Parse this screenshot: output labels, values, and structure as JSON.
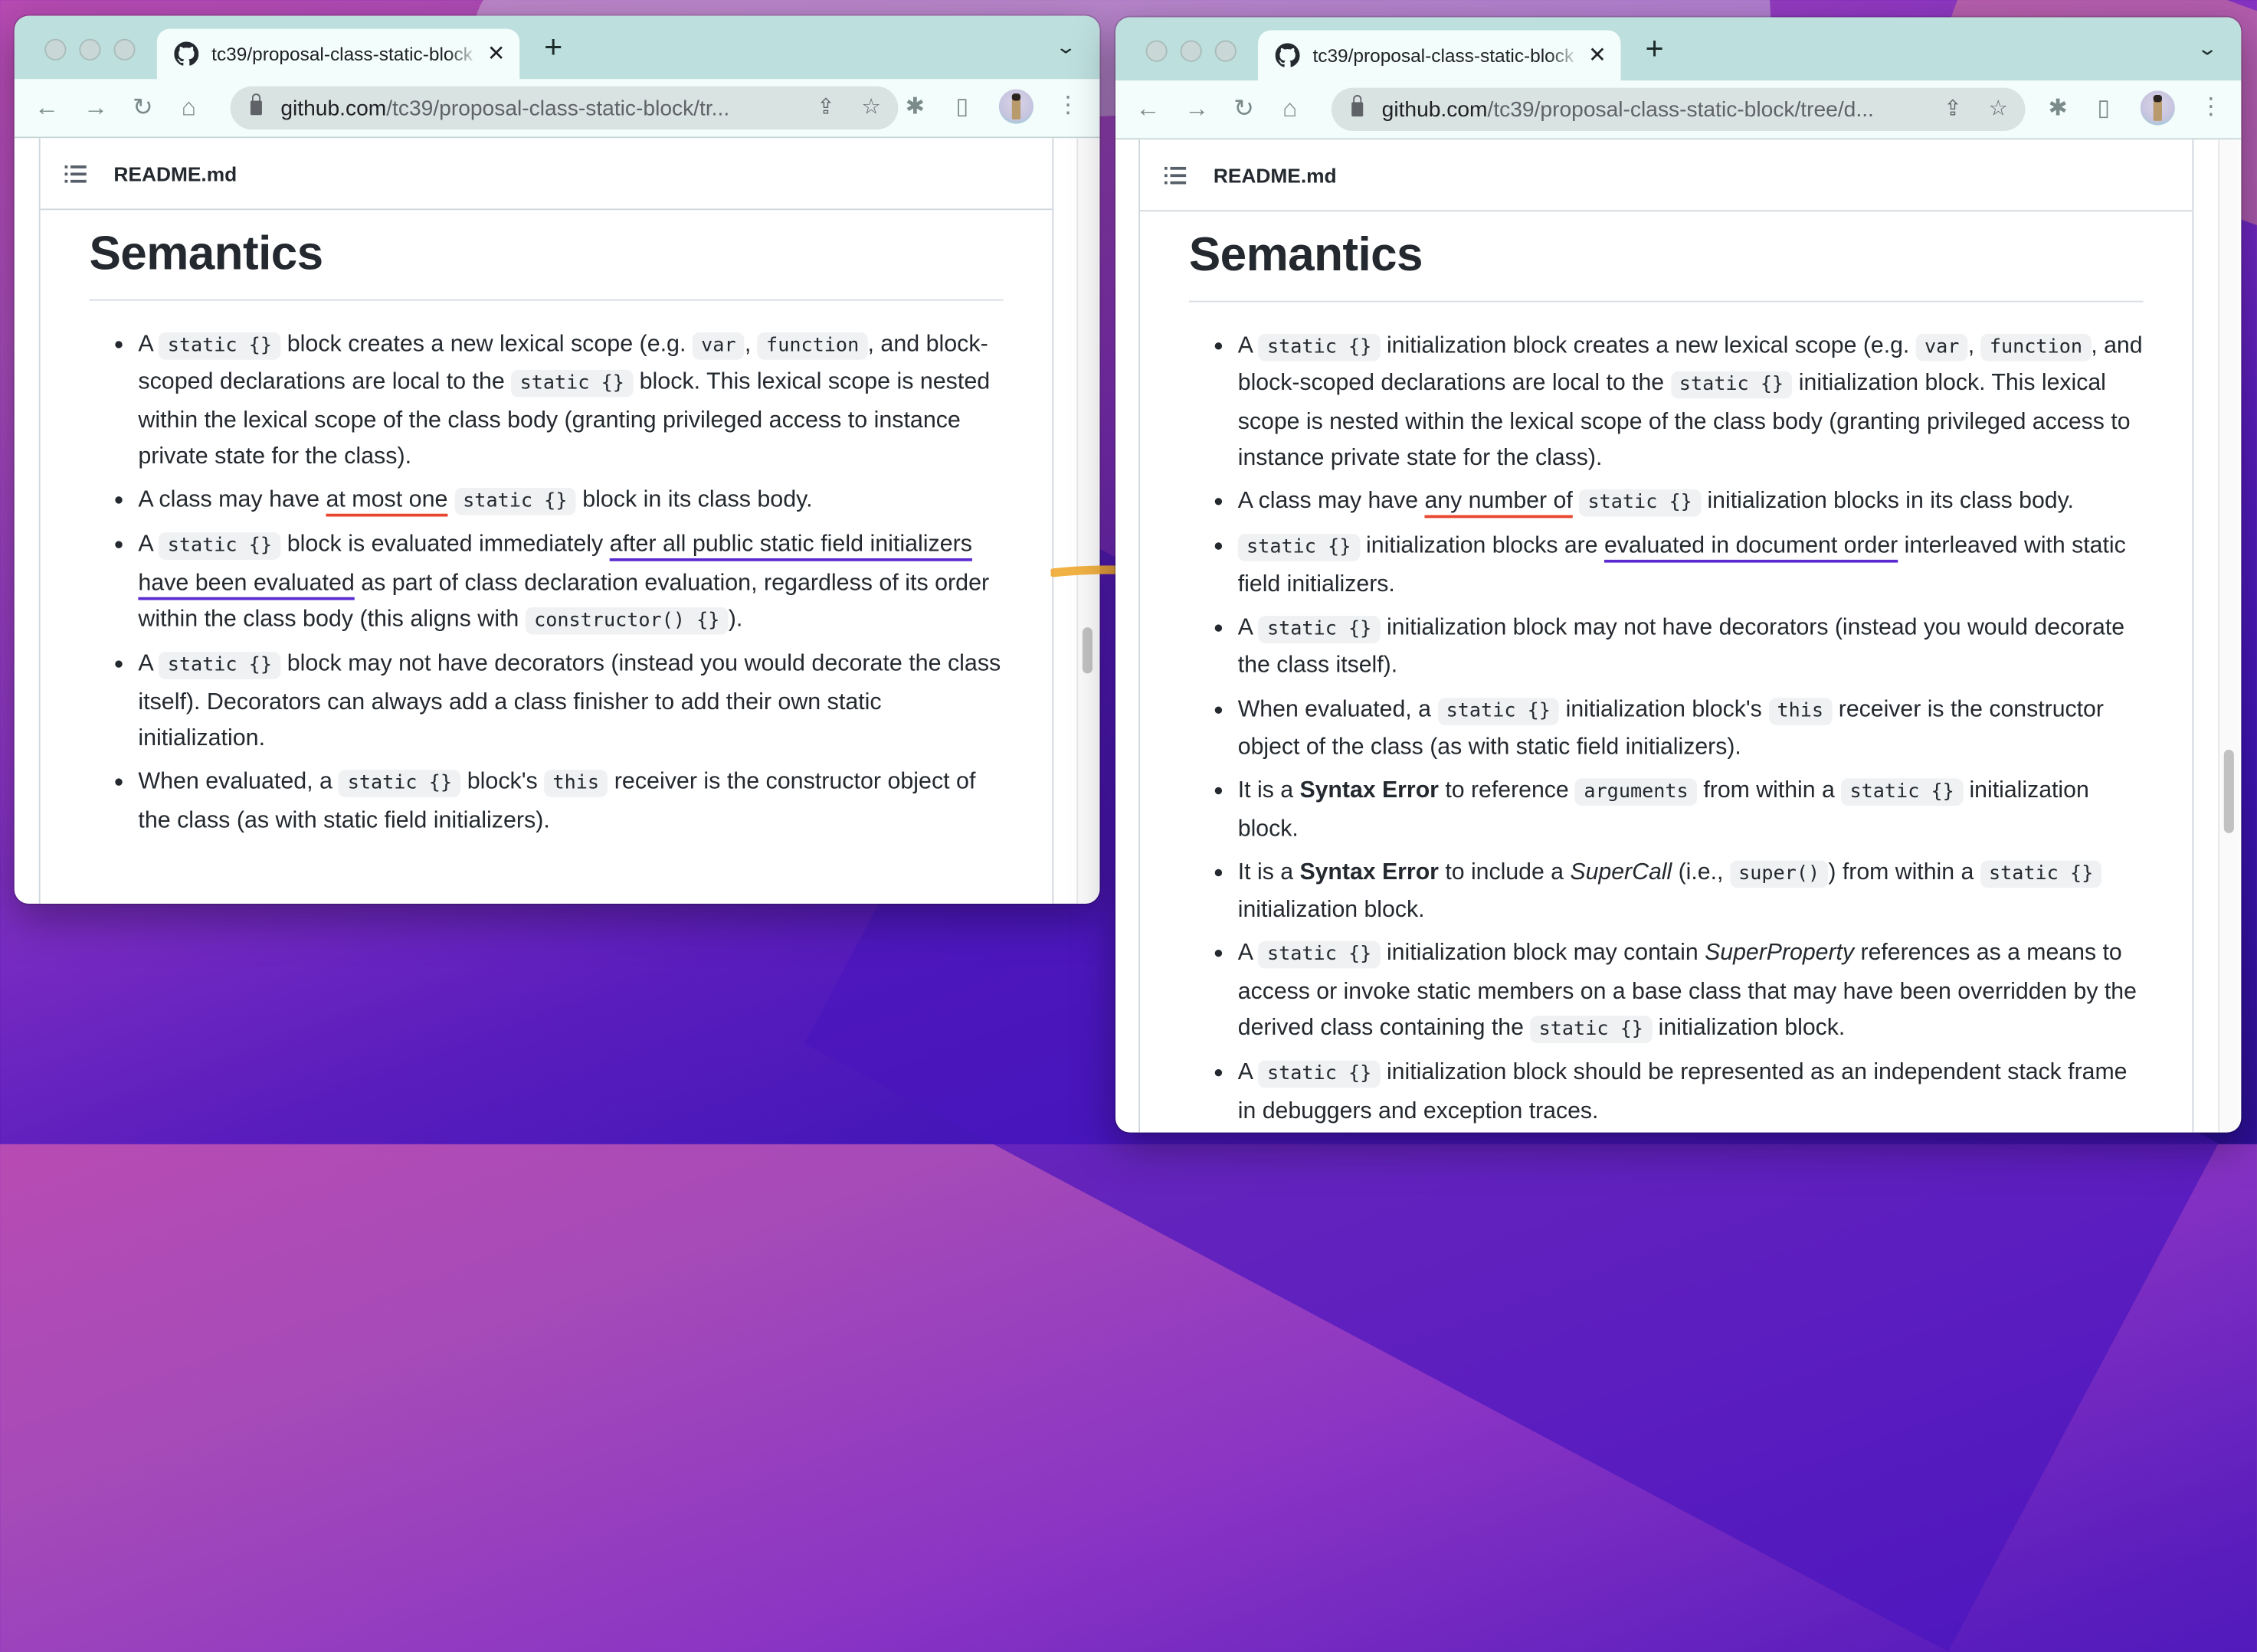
{
  "left_window": {
    "tab_title": "tc39/proposal-class-static-block",
    "url_host": "github.com",
    "url_path": "/tc39/proposal-class-static-block/tr...",
    "file_name": "README.md",
    "heading": "Semantics",
    "bullets": [
      {
        "parts": [
          {
            "t": "text",
            "v": "A "
          },
          {
            "t": "code",
            "v": "static {}"
          },
          {
            "t": "text",
            "v": " block creates a new lexical scope (e.g. "
          },
          {
            "t": "code",
            "v": "var"
          },
          {
            "t": "text",
            "v": ", "
          },
          {
            "t": "code",
            "v": "function"
          },
          {
            "t": "text",
            "v": ", and block-scoped declarations are local to the "
          },
          {
            "t": "code",
            "v": "static {}"
          },
          {
            "t": "text",
            "v": " block. This lexical scope is nested within the lexical scope of the class body (granting privileged access to instance private state for the class)."
          }
        ]
      },
      {
        "parts": [
          {
            "t": "text",
            "v": "A class may have "
          },
          {
            "t": "u-red",
            "v": "at most one"
          },
          {
            "t": "text",
            "v": " "
          },
          {
            "t": "code",
            "v": "static {}"
          },
          {
            "t": "text",
            "v": " block in its class body."
          }
        ]
      },
      {
        "parts": [
          {
            "t": "text",
            "v": "A "
          },
          {
            "t": "code",
            "v": "static {}"
          },
          {
            "t": "text",
            "v": " block is evaluated immediately "
          },
          {
            "t": "u-blue",
            "v": "after all public static field initializers have been evaluated"
          },
          {
            "t": "text",
            "v": " as part of class declaration evaluation, regardless of its order within the class body (this aligns with "
          },
          {
            "t": "code",
            "v": "constructor() {}"
          },
          {
            "t": "text",
            "v": ")."
          }
        ]
      },
      {
        "parts": [
          {
            "t": "text",
            "v": "A "
          },
          {
            "t": "code",
            "v": "static {}"
          },
          {
            "t": "text",
            "v": " block may not have decorators (instead you would decorate the class itself). Decorators can always add a class finisher to add their own static initialization."
          }
        ]
      },
      {
        "parts": [
          {
            "t": "text",
            "v": "When evaluated, a "
          },
          {
            "t": "code",
            "v": "static {}"
          },
          {
            "t": "text",
            "v": " block's "
          },
          {
            "t": "code",
            "v": "this"
          },
          {
            "t": "text",
            "v": " receiver is the constructor object of the class (as with static field initializers)."
          }
        ]
      }
    ]
  },
  "right_window": {
    "tab_title": "tc39/proposal-class-static-block",
    "url_host": "github.com",
    "url_path": "/tc39/proposal-class-static-block/tree/d...",
    "file_name": "README.md",
    "heading": "Semantics",
    "bullets": [
      {
        "parts": [
          {
            "t": "text",
            "v": "A "
          },
          {
            "t": "code",
            "v": "static {}"
          },
          {
            "t": "text",
            "v": " initialization block creates a new lexical scope (e.g. "
          },
          {
            "t": "code",
            "v": "var"
          },
          {
            "t": "text",
            "v": ", "
          },
          {
            "t": "code",
            "v": "function"
          },
          {
            "t": "text",
            "v": ", and block-scoped declarations are local to the "
          },
          {
            "t": "code",
            "v": "static {}"
          },
          {
            "t": "text",
            "v": " initialization block. This lexical scope is nested within the lexical scope of the class body (granting privileged access to instance private state for the class)."
          }
        ]
      },
      {
        "parts": [
          {
            "t": "text",
            "v": "A class may have "
          },
          {
            "t": "u-red",
            "v": "any number of"
          },
          {
            "t": "text",
            "v": " "
          },
          {
            "t": "code",
            "v": "static {}"
          },
          {
            "t": "text",
            "v": " initialization blocks in its class body."
          }
        ]
      },
      {
        "parts": [
          {
            "t": "code",
            "v": "static {}"
          },
          {
            "t": "text",
            "v": " initialization blocks are "
          },
          {
            "t": "u-blue",
            "v": "evaluated in document order"
          },
          {
            "t": "text",
            "v": " interleaved with static field initializers."
          }
        ]
      },
      {
        "parts": [
          {
            "t": "text",
            "v": "A "
          },
          {
            "t": "code",
            "v": "static {}"
          },
          {
            "t": "text",
            "v": " initialization block may not have decorators (instead you would decorate the class itself)."
          }
        ]
      },
      {
        "parts": [
          {
            "t": "text",
            "v": "When evaluated, a "
          },
          {
            "t": "code",
            "v": "static {}"
          },
          {
            "t": "text",
            "v": " initialization block's "
          },
          {
            "t": "code",
            "v": "this"
          },
          {
            "t": "text",
            "v": " receiver is the constructor object of the class (as with static field initializers)."
          }
        ]
      },
      {
        "parts": [
          {
            "t": "text",
            "v": "It is a "
          },
          {
            "t": "bold",
            "v": "Syntax Error"
          },
          {
            "t": "text",
            "v": " to reference "
          },
          {
            "t": "code",
            "v": "arguments"
          },
          {
            "t": "text",
            "v": " from within a "
          },
          {
            "t": "code",
            "v": "static {}"
          },
          {
            "t": "text",
            "v": " initialization block."
          }
        ]
      },
      {
        "parts": [
          {
            "t": "text",
            "v": "It is a "
          },
          {
            "t": "bold",
            "v": "Syntax Error"
          },
          {
            "t": "text",
            "v": " to include a "
          },
          {
            "t": "italic",
            "v": "SuperCall"
          },
          {
            "t": "text",
            "v": " (i.e., "
          },
          {
            "t": "code",
            "v": "super()"
          },
          {
            "t": "text",
            "v": ") from within a "
          },
          {
            "t": "code",
            "v": "static {}"
          },
          {
            "t": "text",
            "v": " initialization block."
          }
        ]
      },
      {
        "parts": [
          {
            "t": "text",
            "v": "A "
          },
          {
            "t": "code",
            "v": "static {}"
          },
          {
            "t": "text",
            "v": " initialization block may contain "
          },
          {
            "t": "italic",
            "v": "SuperProperty"
          },
          {
            "t": "text",
            "v": " references as a means to access or invoke static members on a base class that may have been overridden by the derived class containing the "
          },
          {
            "t": "code",
            "v": "static {}"
          },
          {
            "t": "text",
            "v": " initialization block."
          }
        ]
      },
      {
        "parts": [
          {
            "t": "text",
            "v": "A "
          },
          {
            "t": "code",
            "v": "static {}"
          },
          {
            "t": "text",
            "v": " initialization block should be represented as an independent stack frame in debuggers and exception traces."
          }
        ]
      }
    ]
  },
  "icons": {
    "back": "←",
    "forward": "→",
    "reload": "↻",
    "home": "⌂",
    "share": "⇪",
    "star": "☆",
    "extensions": "✱",
    "sidepanel": "▯",
    "menu": "⋮",
    "close_tab": "✕",
    "new_tab": "+",
    "tab_search": "⌄"
  },
  "colors": {
    "accent_arrow": "#f0a830",
    "underline_red": "#e8452c",
    "underline_blue": "#5b2bd1",
    "tabbar": "#bddfde"
  }
}
